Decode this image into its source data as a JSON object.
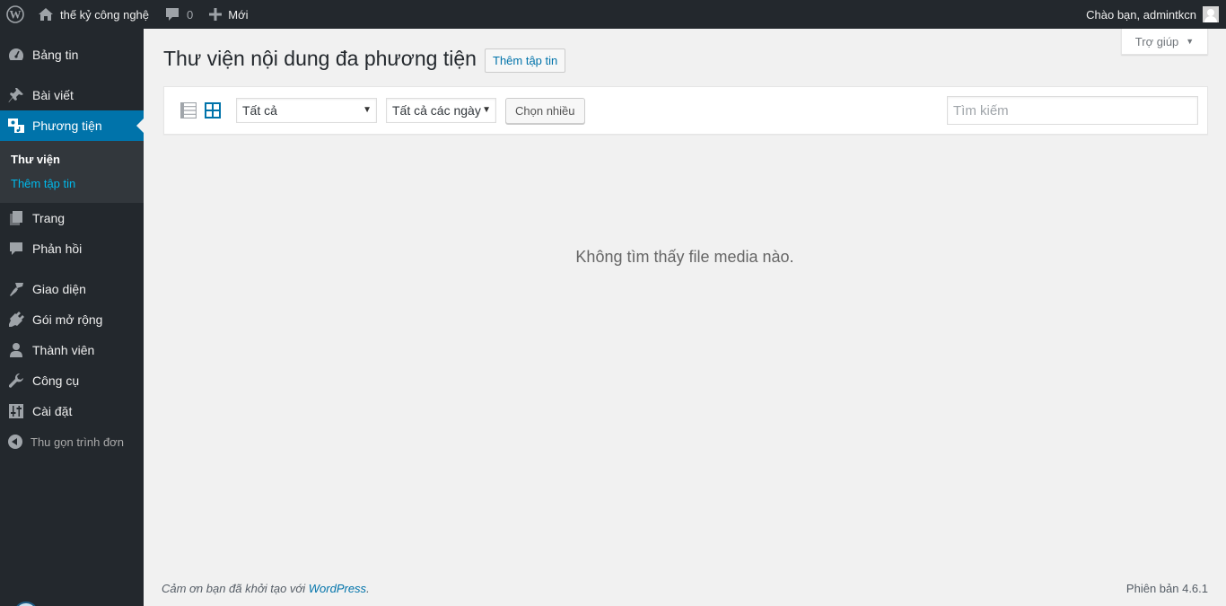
{
  "adminbar": {
    "site_name": "thế kỷ công nghệ",
    "comments_count": "0",
    "new_label": "Mới",
    "greeting": "Chào bạn, admintkcn",
    "icons": {
      "logo": "wordpress-logo-icon",
      "home": "home-icon",
      "comments": "comment-bubble-icon",
      "new": "plus-icon",
      "avatar": "user-avatar-icon"
    }
  },
  "sidebar": {
    "items": [
      {
        "label": "Bảng tin",
        "icon": "dashboard-icon"
      },
      {
        "label": "Bài viết",
        "icon": "pushpin-icon"
      },
      {
        "label": "Phương tiện",
        "icon": "media-icon",
        "active": true
      },
      {
        "label": "Trang",
        "icon": "page-icon"
      },
      {
        "label": "Phản hồi",
        "icon": "comment-icon"
      },
      {
        "label": "Giao diện",
        "icon": "paintbrush-icon"
      },
      {
        "label": "Gói mở rộng",
        "icon": "plugin-icon"
      },
      {
        "label": "Thành viên",
        "icon": "user-icon"
      },
      {
        "label": "Công cụ",
        "icon": "wrench-icon"
      },
      {
        "label": "Cài đặt",
        "icon": "settings-icon"
      }
    ],
    "submenu": [
      {
        "label": "Thư viện",
        "current": true
      },
      {
        "label": "Thêm tập tin",
        "current": false
      }
    ],
    "collapse_label": "Thu gọn trình đơn"
  },
  "help_tab": {
    "label": "Trợ giúp"
  },
  "page": {
    "title": "Thư viện nội dung đa phương tiện",
    "add_new_label": "Thêm tập tin"
  },
  "toolbar": {
    "filter_type": {
      "selected": "Tất cả"
    },
    "filter_date": {
      "selected": "Tất cả các ngày"
    },
    "bulk_select_label": "Chọn nhiều",
    "search": {
      "placeholder": "Tìm kiếm",
      "value": ""
    },
    "view_mode": "grid"
  },
  "empty_message": "Không tìm thấy file media nào.",
  "footer": {
    "thanks_text": "Cảm ơn bạn đã khởi tạo với ",
    "wordpress_link": "WordPress",
    "thanks_suffix": ".",
    "version": "Phiên bản 4.6.1"
  },
  "colors": {
    "accent": "#0073aa",
    "adminbar_bg": "#23282d",
    "submenu_bg": "#32373c",
    "submenu_link": "#00b9eb",
    "page_bg": "#f1f1f1"
  }
}
